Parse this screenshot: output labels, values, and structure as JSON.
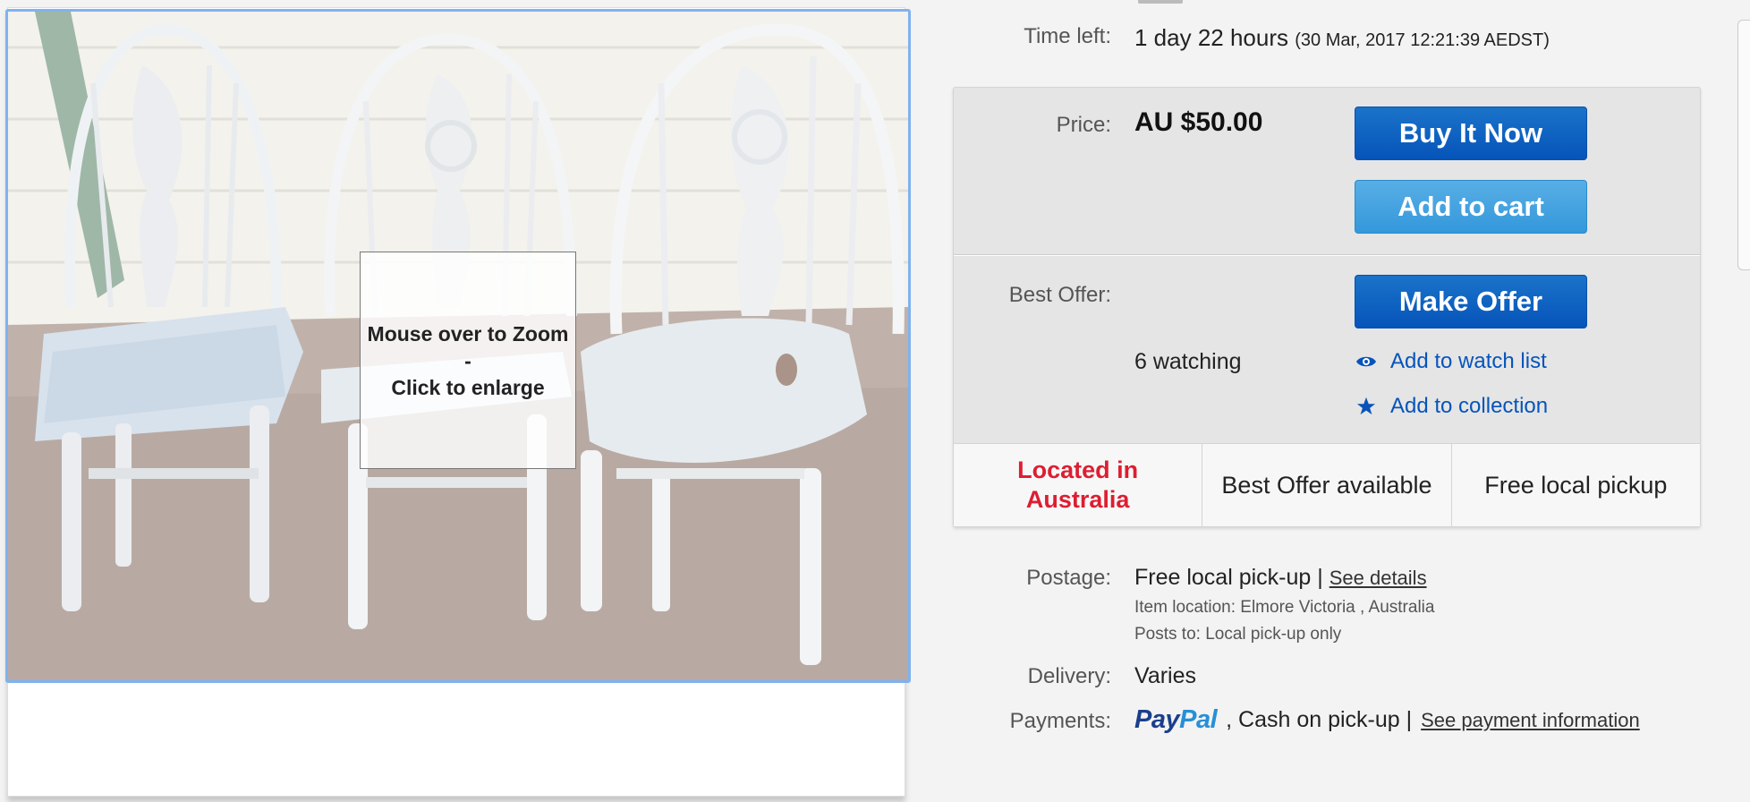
{
  "listing": {
    "time_left_label": "Time left:",
    "time_left_value": "1 day 22 hours",
    "time_left_end": "(30 Mar, 2017   12:21:39 AEDST)",
    "price_label": "Price:",
    "price_value": "AU $50.00",
    "buy_now_label": "Buy It Now",
    "add_to_cart_label": "Add to cart",
    "best_offer_label": "Best Offer:",
    "make_offer_label": "Make Offer",
    "watching_text": "6 watching",
    "add_watch_list_label": "Add to watch list",
    "add_collection_label": "Add to collection"
  },
  "image_viewer": {
    "zoom_hint_line1": "Mouse over to Zoom",
    "zoom_hint_line2": "-",
    "zoom_hint_line3": "Click to enlarge"
  },
  "badges": {
    "location_line1": "Located in",
    "location_line2": "Australia",
    "best_offer": "Best Offer available",
    "pickup": "Free local pickup"
  },
  "shipping": {
    "postage_label": "Postage:",
    "postage_value": "Free local pick-up",
    "separator": "|",
    "see_details_label": "See details",
    "item_location": "Item location:  Elmore Victoria , Australia",
    "posts_to": "Posts to:  Local pick-up only",
    "delivery_label": "Delivery:",
    "delivery_value": "Varies",
    "payments_label": "Payments:",
    "paypal_pay": "Pay",
    "paypal_pal": "Pal",
    "payments_value": ",  Cash on pick-up  |",
    "see_payment_label": "See payment information"
  },
  "colors": {
    "primary_button": "#0654ba",
    "secondary_button": "#3498db",
    "location_badge": "#dd1e31",
    "link": "#0654ba"
  },
  "icons": {
    "watch": "eye-icon",
    "collection": "star-icon"
  }
}
